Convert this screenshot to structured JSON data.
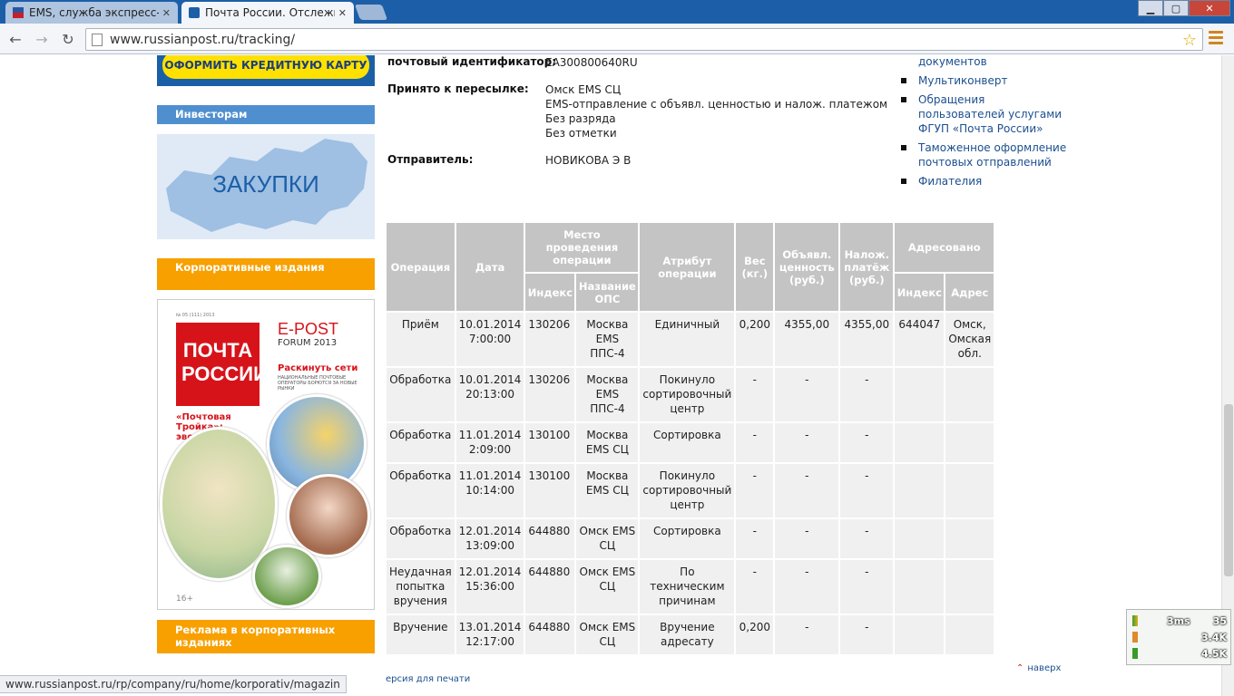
{
  "browser": {
    "tabs": [
      {
        "label": "EMS, служба экспресс-до",
        "active": false
      },
      {
        "label": "Почта России. Отслежив",
        "active": true
      }
    ],
    "url": "www.russianpost.ru/tracking/",
    "status_url": "www.russianpost.ru/rp/company/ru/home/korporativ/magazin",
    "window_buttons": [
      "minimize",
      "maximize",
      "close"
    ]
  },
  "sidebar": {
    "credit_button": "ОФОРМИТЬ КРЕДИТНУЮ КАРТУ",
    "investors": "Инвесторам",
    "zakupki": "ЗАКУПКИ",
    "corporate": "Корпоративные издания",
    "ads": "Реклама в корпоративных изданиях",
    "magazine": {
      "issue": "№ 05 (111) 2013",
      "brand_small": "RUSSIAN POST",
      "brand": "ПОЧТА РОССИИ",
      "epost": "E-POST",
      "forum": "FORUM 2013",
      "headline": "Раскинуть сети",
      "sub": "НАЦИОНАЛЬНЫЕ ПОЧТОВЫЕ ОПЕРАТОРЫ БОРЮТСЯ ЗА НОВЫЕ РЫНКИ",
      "troika": "«Почтовая Тройка»: эволюция",
      "age": "16+"
    }
  },
  "info": {
    "identifier_label": "почтовый идентификатор:",
    "identifier_value": "EA300800640RU",
    "accepted_label": "Принято к пересылке:",
    "accepted_lines": [
      "Омск EMS СЦ",
      "EMS-отправление с объявл. ценностью и налож. платежом",
      "Без разряда",
      "Без отметки"
    ],
    "sender_label": "Отправитель:",
    "sender_value": "НОВИКОВА Э В"
  },
  "right_links": [
    "документов",
    "Мультиконверт",
    "Обращения пользователей услугами ФГУП «Почта России»",
    "Таможенное оформление почтовых отправлений",
    "Филателия"
  ],
  "table": {
    "headers": {
      "operation": "Операция",
      "date": "Дата",
      "place": "Место проведения операции",
      "index": "Индекс",
      "ops_name": "Название ОПС",
      "attribute": "Атрибут операции",
      "weight": "Вес (кг.)",
      "declared": "Объявл. ценность (руб.)",
      "cod": "Налож. платёж (руб.)",
      "addressed": "Адресовано",
      "addr_index": "Индекс",
      "addr": "Адрес"
    },
    "rows": [
      {
        "op": "Приём",
        "date": "10.01.2014 7:00:00",
        "index": "130206",
        "name": "Москва EMS ППС-4",
        "attr": "Единичный",
        "weight": "0,200",
        "declared": "4355,00",
        "cod": "4355,00",
        "aindex": "644047",
        "addr": "Омск, Омская обл."
      },
      {
        "op": "Обработка",
        "date": "10.01.2014 20:13:00",
        "index": "130206",
        "name": "Москва EMS ППС-4",
        "attr": "Покинуло сортировочный центр",
        "weight": "-",
        "declared": "-",
        "cod": "-",
        "aindex": "",
        "addr": ""
      },
      {
        "op": "Обработка",
        "date": "11.01.2014 2:09:00",
        "index": "130100",
        "name": "Москва EMS СЦ",
        "attr": "Сортировка",
        "weight": "-",
        "declared": "-",
        "cod": "-",
        "aindex": "",
        "addr": ""
      },
      {
        "op": "Обработка",
        "date": "11.01.2014 10:14:00",
        "index": "130100",
        "name": "Москва EMS СЦ",
        "attr": "Покинуло сортировочный центр",
        "weight": "-",
        "declared": "-",
        "cod": "-",
        "aindex": "",
        "addr": ""
      },
      {
        "op": "Обработка",
        "date": "12.01.2014 13:09:00",
        "index": "644880",
        "name": "Омск EMS СЦ",
        "attr": "Сортировка",
        "weight": "-",
        "declared": "-",
        "cod": "-",
        "aindex": "",
        "addr": ""
      },
      {
        "op": "Неудачная попытка вручения",
        "date": "12.01.2014 15:36:00",
        "index": "644880",
        "name": "Омск EMS СЦ",
        "attr": "По техническим причинам",
        "weight": "-",
        "declared": "-",
        "cod": "-",
        "aindex": "",
        "addr": ""
      },
      {
        "op": "Вручение",
        "date": "13.01.2014 12:17:00",
        "index": "644880",
        "name": "Омск EMS СЦ",
        "attr": "Вручение адресату",
        "weight": "0,200",
        "declared": "-",
        "cod": "-",
        "aindex": "",
        "addr": ""
      }
    ]
  },
  "footer": {
    "print": "ерсия для печати",
    "top": "наверх"
  },
  "widget": {
    "ping": "3ms",
    "count": "35",
    "upload": "3.4K",
    "download": "4.5K"
  }
}
